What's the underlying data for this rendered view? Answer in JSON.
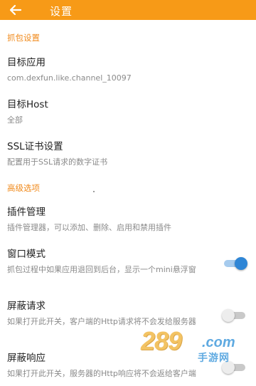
{
  "appbar": {
    "title": "设置",
    "back_icon": "arrow-left-icon",
    "color": "#f79a17"
  },
  "sections": {
    "capture": {
      "header": "抓包设置"
    },
    "advanced": {
      "header": "高级选项"
    }
  },
  "prefs": {
    "target_app": {
      "title": "目标应用",
      "summary": "com.dexfun.like.channel_10097"
    },
    "target_host": {
      "title": "目标Host",
      "summary": "全部"
    },
    "ssl_cert": {
      "title": "SSL证书设置",
      "summary": "配置用于SSL请求的数字证书"
    },
    "plugins": {
      "title": "插件管理",
      "summary": "插件管理器，可以添加、删除、启用和禁用插件"
    },
    "window_mode": {
      "title": "窗口模式",
      "summary": "抓包过程中如果应用退回到后台，显示一个mini悬浮窗",
      "enabled": true
    },
    "block_request": {
      "title": "屏蔽请求",
      "summary": "如果打开此开关，客户端的Http请求将不会发给服务器",
      "enabled": false
    },
    "block_response": {
      "title": "屏蔽响应",
      "summary": "如果打开此开关，服务器的Http响应将不会返给客户端",
      "enabled": false
    }
  },
  "colors": {
    "section_header": "#f08a1c",
    "switch_on": "#2f86d6"
  },
  "watermark": {
    "number": "289",
    "domain": ".com",
    "name": "手游网"
  }
}
